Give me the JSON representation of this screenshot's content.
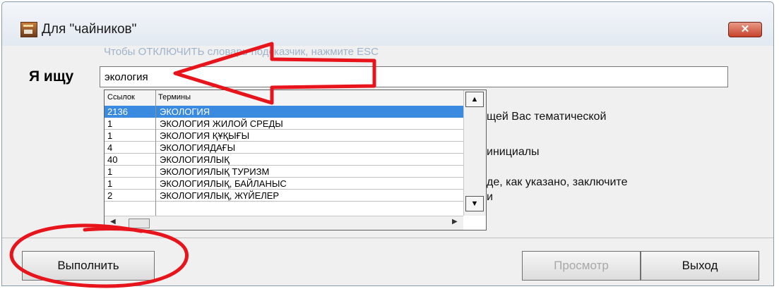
{
  "window": {
    "title": "Для \"чайников\"",
    "close_label": "✕"
  },
  "hint_text": "Чтобы ОТКЛЮЧИТЬ словарь-подсказчик, нажмите ESC",
  "search": {
    "label": "Я ищу",
    "value": "экология"
  },
  "background_text": [
    "щей Вас тематической",
    "инициалы",
    "де, как указано, заключите",
    "и"
  ],
  "dropdown": {
    "columns": [
      "Ссылок",
      "Термины"
    ],
    "rows": [
      {
        "count": "2136",
        "term": "ЭКОЛОГИЯ",
        "selected": true
      },
      {
        "count": "1",
        "term": "ЭКОЛОГИЯ ЖИЛОЙ СРЕДЫ"
      },
      {
        "count": "1",
        "term": "ЭКОЛОГИЯ ҚҰҚЫҒЫ"
      },
      {
        "count": "4",
        "term": "ЭКОЛОГИЯДАҒЫ"
      },
      {
        "count": "40",
        "term": "ЭКОЛОГИЯЛЫҚ"
      },
      {
        "count": "1",
        "term": "ЭКОЛОГИЯЛЫҚ ТУРИЗМ"
      },
      {
        "count": "1",
        "term": "ЭКОЛОГИЯЛЫҚ, БАЙЛАНЫС"
      },
      {
        "count": "2",
        "term": "ЭКОЛОГИЯЛЫҚ, ЖҮЙЕЛЕР"
      }
    ]
  },
  "buttons": {
    "execute": "Выполнить",
    "preview": "Просмотр",
    "exit": "Выход"
  },
  "colors": {
    "annotation": "#e8141b",
    "selection": "#3a8ae0",
    "hint": "#9fb3cc"
  }
}
